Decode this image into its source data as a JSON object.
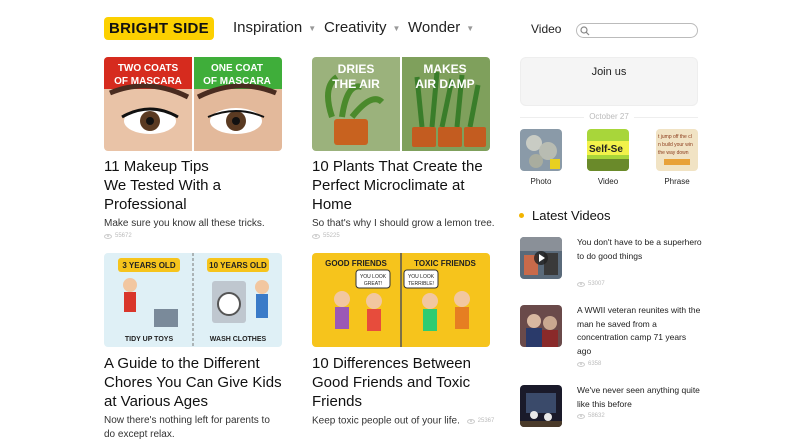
{
  "header": {
    "logo": "BRIGHT SIDE",
    "nav": [
      "Inspiration",
      "Creativity",
      "Wonder"
    ],
    "video": "Video"
  },
  "articles": [
    {
      "title": "11 Makeup Tips We Tested With a Professional",
      "desc": "Make sure you know all these tricks.",
      "views": "55672",
      "thumb_labels": [
        "TWO COATS OF MASCARA",
        "ONE COAT OF MASCARA"
      ]
    },
    {
      "title": "10 Plants That Create the Perfect Microclimate at Home",
      "desc": "So that's why I should grow a lemon tree.",
      "views": "55225",
      "thumb_labels": [
        "DRIES THE AIR",
        "MAKES AIR DAMP"
      ]
    },
    {
      "title": "A Guide to the Different Chores You Can Give Kids at Various Ages",
      "desc": "Now there's nothing left for parents to do except relax.",
      "views": "55265",
      "thumb_labels": [
        "3 YEARS OLD",
        "10 YEARS OLD",
        "TIDY UP TOYS",
        "WASH CLOTHES"
      ]
    },
    {
      "title": "10 Differences Between Good Friends and Toxic Friends",
      "desc": "Keep toxic people out of your life.",
      "views": "25367",
      "thumb_labels": [
        "GOOD FRIENDS",
        "TOXIC FRIENDS",
        "YOU LOOK GREAT!",
        "YOU LOOK TERRIBLE!"
      ]
    }
  ],
  "sidebar": {
    "join": "Join us",
    "date": "October 27",
    "categories": [
      "Photo",
      "Video",
      "Phrase"
    ],
    "latest_title": "Latest Videos",
    "videos": [
      {
        "text": "You don't have to be a superhero to do good things",
        "views": "53007"
      },
      {
        "text": "A WWII veteran reunites with the man he saved from a concentration camp 71 years ago",
        "views": "6358"
      },
      {
        "text": "We've never seen anything quite like this before",
        "views": "58632"
      }
    ]
  },
  "colors": {
    "brand": "#fcd000",
    "green": "#3fae3a",
    "red": "#d62b1e",
    "yellow": "#f6c41c"
  }
}
